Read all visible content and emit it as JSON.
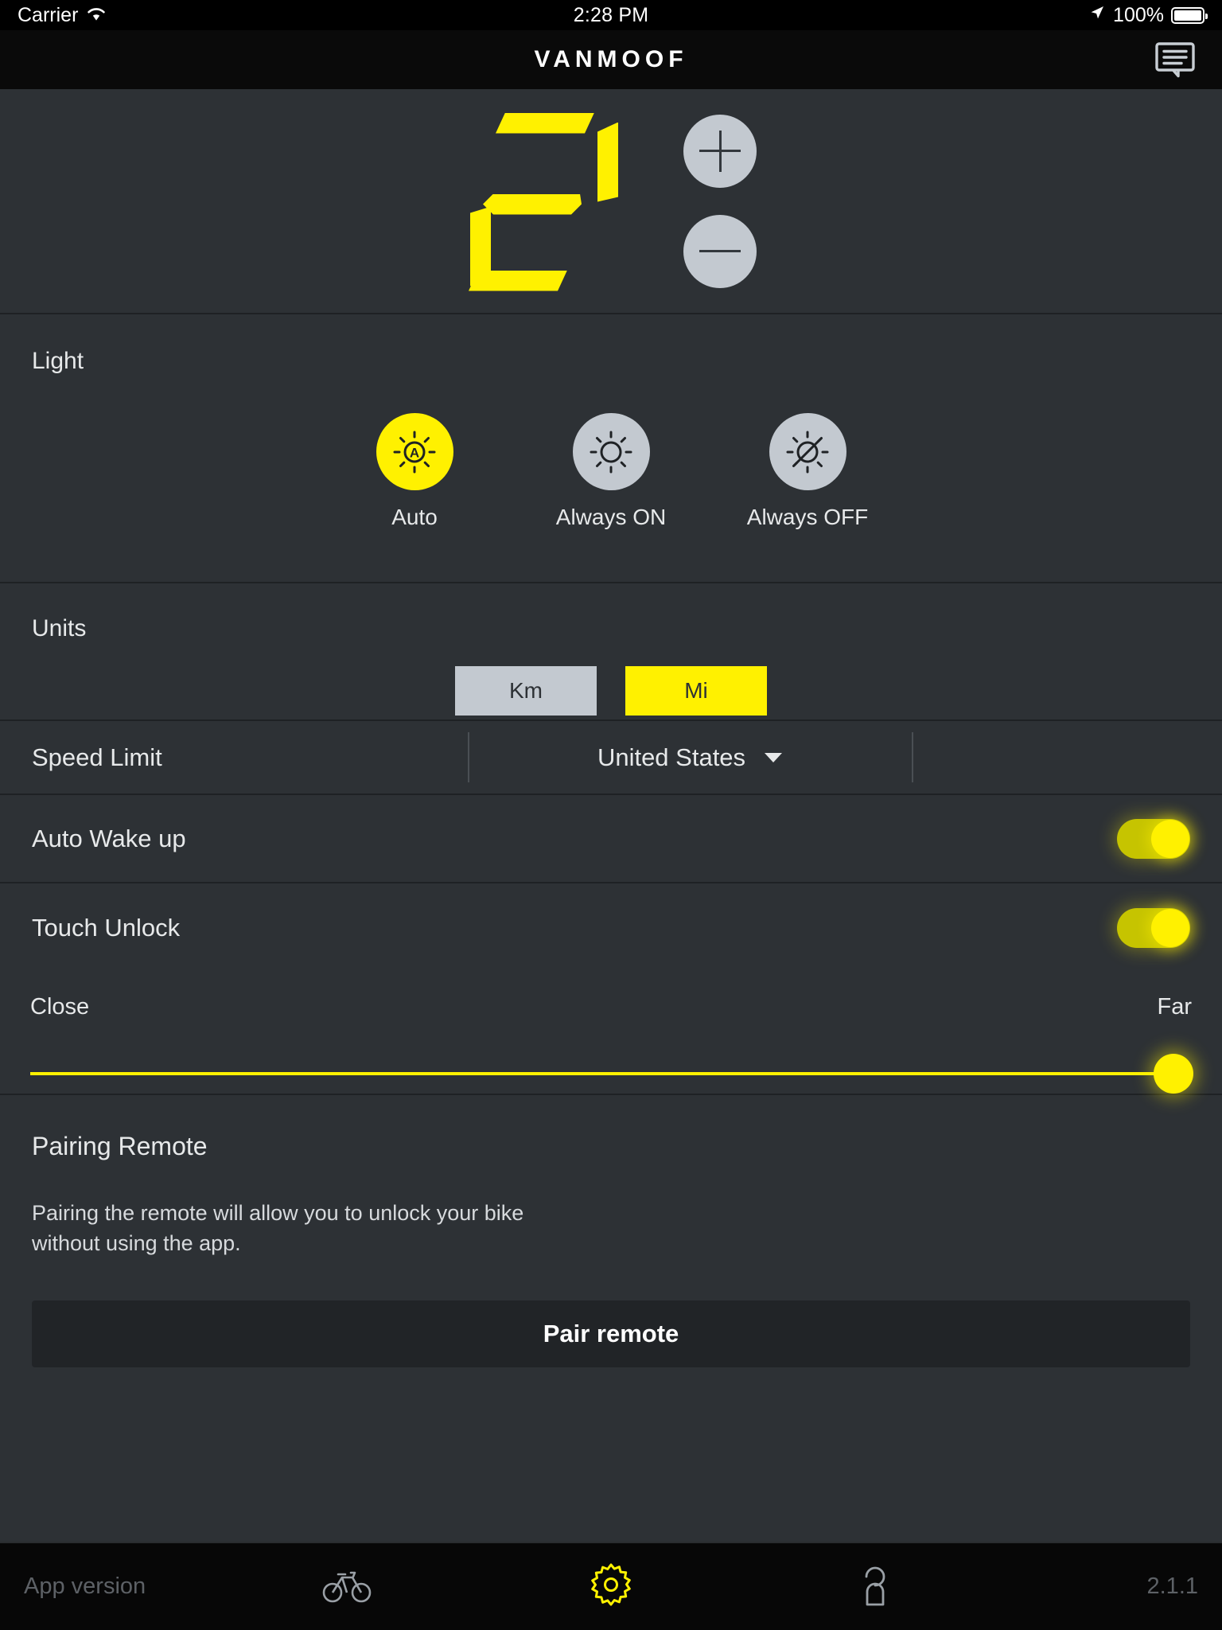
{
  "status_bar": {
    "carrier": "Carrier",
    "wifi_icon": "wifi-icon",
    "time": "2:28 PM",
    "location_icon": "location-arrow-icon",
    "battery_percent": "100%",
    "battery_icon": "battery-full-icon"
  },
  "header": {
    "brand": "VANMOOF",
    "message_icon": "message-bubble-icon"
  },
  "assist": {
    "level": "2",
    "increase_label": "+",
    "decrease_label": "−",
    "plus_icon": "plus-icon",
    "minus_icon": "minus-icon"
  },
  "light": {
    "title": "Light",
    "options": [
      {
        "label": "Auto",
        "icon": "sun-auto-icon",
        "selected": true
      },
      {
        "label": "Always ON",
        "icon": "sun-icon",
        "selected": false
      },
      {
        "label": "Always OFF",
        "icon": "sun-off-icon",
        "selected": false
      }
    ]
  },
  "units": {
    "title": "Units",
    "options": [
      {
        "label": "Km",
        "selected": false
      },
      {
        "label": "Mi",
        "selected": true
      }
    ]
  },
  "speed_limit": {
    "label": "Speed Limit",
    "value": "United States",
    "caret_icon": "chevron-down-icon"
  },
  "auto_wake": {
    "label": "Auto Wake up",
    "state": "on"
  },
  "touch_unlock": {
    "label": "Touch Unlock",
    "state": "on"
  },
  "range_slider": {
    "min_label": "Close",
    "max_label": "Far",
    "value_percent": "100"
  },
  "pairing": {
    "title": "Pairing Remote",
    "description": "Pairing the remote will allow you to unlock your bike without using the app.",
    "button_label": "Pair remote"
  },
  "tabbar": {
    "version_label": "App version",
    "version_number": "2.1.1",
    "items": [
      {
        "icon": "bicycle-icon",
        "active": false
      },
      {
        "icon": "gear-icon",
        "active": true
      },
      {
        "icon": "person-icon",
        "active": false
      }
    ]
  },
  "colors": {
    "accent_yellow": "#fff100",
    "panel": "#2d3135",
    "nav_black": "#0a0a0a",
    "icon_gray": "#c3c9d0"
  }
}
